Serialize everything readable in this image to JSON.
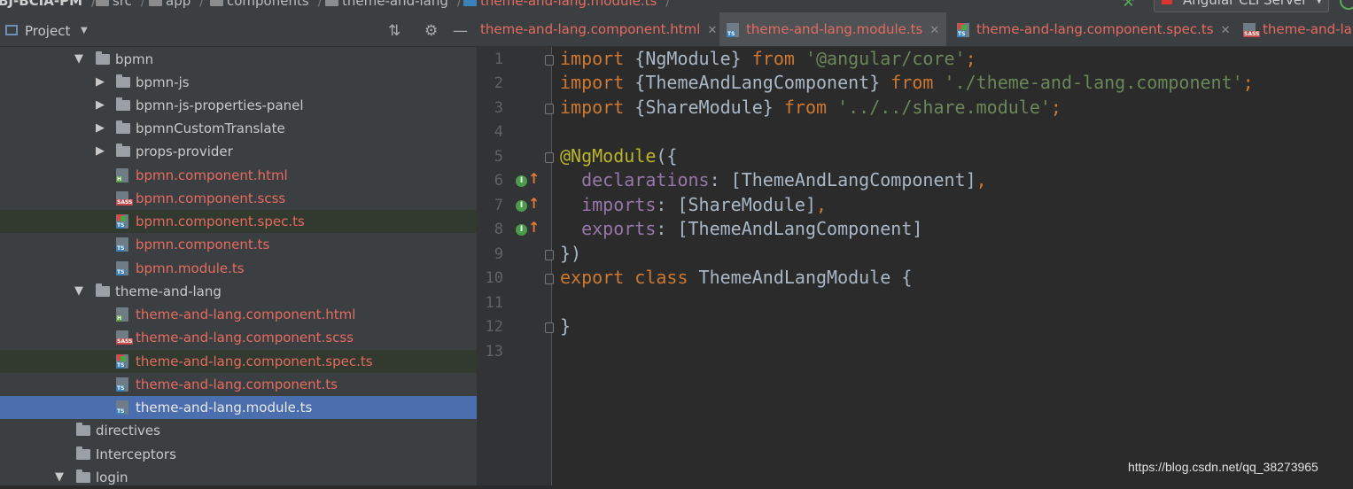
{
  "breadcrumb": {
    "project": "BJ-BCIA-PM",
    "items": [
      "src",
      "app",
      "components",
      "theme-and-lang"
    ],
    "active_file": "theme-and-lang.module.ts"
  },
  "toolbar": {
    "run_config": "Angular CLI Server"
  },
  "project_panel": {
    "title": "Project",
    "tree": [
      {
        "label": "bpmn",
        "kind": "dir",
        "expanded": true
      },
      {
        "label": "bpmn-js",
        "kind": "dir"
      },
      {
        "label": "bpmn-js-properties-panel",
        "kind": "dir"
      },
      {
        "label": "bpmnCustomTranslate",
        "kind": "dir"
      },
      {
        "label": "props-provider",
        "kind": "dir"
      },
      {
        "label": "bpmn.component.html",
        "kind": "html"
      },
      {
        "label": "bpmn.component.scss",
        "kind": "scss"
      },
      {
        "label": "bpmn.component.spec.ts",
        "kind": "spec"
      },
      {
        "label": "bpmn.component.ts",
        "kind": "ts"
      },
      {
        "label": "bpmn.module.ts",
        "kind": "ts"
      },
      {
        "label": "theme-and-lang",
        "kind": "dir",
        "expanded": true
      },
      {
        "label": "theme-and-lang.component.html",
        "kind": "html"
      },
      {
        "label": "theme-and-lang.component.scss",
        "kind": "scss"
      },
      {
        "label": "theme-and-lang.component.spec.ts",
        "kind": "spec"
      },
      {
        "label": "theme-and-lang.component.ts",
        "kind": "ts"
      },
      {
        "label": "theme-and-lang.module.ts",
        "kind": "ts",
        "selected": true
      },
      {
        "label": "directives",
        "kind": "dir"
      },
      {
        "label": "Interceptors",
        "kind": "dir"
      },
      {
        "label": "login",
        "kind": "dir",
        "expanded": true
      }
    ]
  },
  "editor": {
    "tabs": [
      {
        "label": "theme-and-lang.component.html"
      },
      {
        "label": "theme-and-lang.module.ts",
        "active": true
      },
      {
        "label": "theme-and-lang.component.spec.ts"
      },
      {
        "label": "theme-and-lang.component.scss"
      }
    ],
    "line_numbers": [
      "1",
      "2",
      "3",
      "4",
      "5",
      "6",
      "7",
      "8",
      "9",
      "10",
      "11",
      "12",
      "13"
    ],
    "code": {
      "l1": {
        "a": "import",
        "b": " {NgModule} ",
        "c": "from",
        "d": " ",
        "e": "'@angular/core'",
        "f": ";"
      },
      "l2": {
        "a": "import",
        "b": " {ThemeAndLangComponent} ",
        "c": "from",
        "d": " ",
        "e": "'./theme-and-lang.component'",
        "f": ";"
      },
      "l3": {
        "a": "import",
        "b": " {ShareModule} ",
        "c": "from",
        "d": " ",
        "e": "'../../share.module'",
        "f": ";"
      },
      "l5": {
        "a": "@NgModule",
        "b": "({"
      },
      "l6": {
        "a": "  ",
        "b": "declarations",
        "c": ": [ThemeAndLangComponent]",
        "d": ","
      },
      "l7": {
        "a": "  ",
        "b": "imports",
        "c": ": [ShareModule]",
        "d": ","
      },
      "l8": {
        "a": "  ",
        "b": "exports",
        "c": ": [ThemeAndLangComponent]"
      },
      "l9": {
        "a": "})"
      },
      "l10": {
        "a": "export",
        "b": " ",
        "c": "class",
        "d": " ThemeAndLangModule {"
      },
      "l12": {
        "a": "}"
      }
    }
  },
  "watermark": "https://blog.csdn.net/qq_38273965",
  "colors": {
    "keyword": "#cc7832",
    "string": "#6a8759",
    "annotation": "#bbb529",
    "property": "#9876aa",
    "modified_file": "#e56b60",
    "selection": "#4b6eaf"
  }
}
